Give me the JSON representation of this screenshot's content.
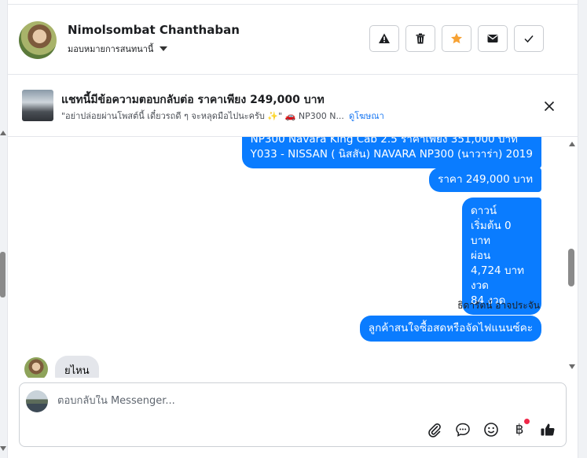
{
  "header": {
    "contact_name": "Nimolsombat Chanthaban",
    "assign_label": "มอบหมายการสนทนานี้",
    "actions": [
      {
        "name": "warning-icon"
      },
      {
        "name": "trash-icon"
      },
      {
        "name": "star-icon"
      },
      {
        "name": "mail-icon"
      },
      {
        "name": "check-icon"
      }
    ]
  },
  "ad": {
    "title": "แชทนี้มีข้อความตอบกลับต่อ ราคาเพียง 249,000 บาท",
    "subtitle": "\"อย่าปล่อยผ่านโพสต์นี้ เดี๋ยวรถดี ๆ จะหลุดมือไปนะครับ ✨\" 🚗 NP300 N...",
    "link": "ดูโฆษณา"
  },
  "messages": {
    "m1_line1": "NP300 Navara King Cab 2.5 ราคาเพียง 351,000 บาท",
    "m1_line2": "Y033 - NISSAN ( นิสสัน) NAVARA NP300 (นาวาร่า) 2019",
    "m2": "ราคา 249,000 บาท",
    "m3_lines": [
      "ดาวน์",
      "เริ่มต้น 0 บาท",
      "ผ่อน",
      "4,724 บาท",
      "งวด",
      "84 งวด"
    ],
    "sender": "ธิดารัตน์ อาจประจัน",
    "m4": "ลูกค้าสนใจซื้อสดหรือจัดไฟแนนซ์คะ",
    "incoming": "ยไหน"
  },
  "composer": {
    "placeholder": "ตอบกลับใน Messenger...",
    "tools": [
      "paperclip-icon",
      "chat-bubble-icon",
      "smiley-icon",
      "baht-icon",
      "thumbs-up-icon"
    ],
    "baht_symbol": "฿"
  },
  "colors": {
    "bubble": "#0a7cff",
    "star": "#f7a234",
    "link": "#1877f2",
    "badge": "#f02849"
  }
}
